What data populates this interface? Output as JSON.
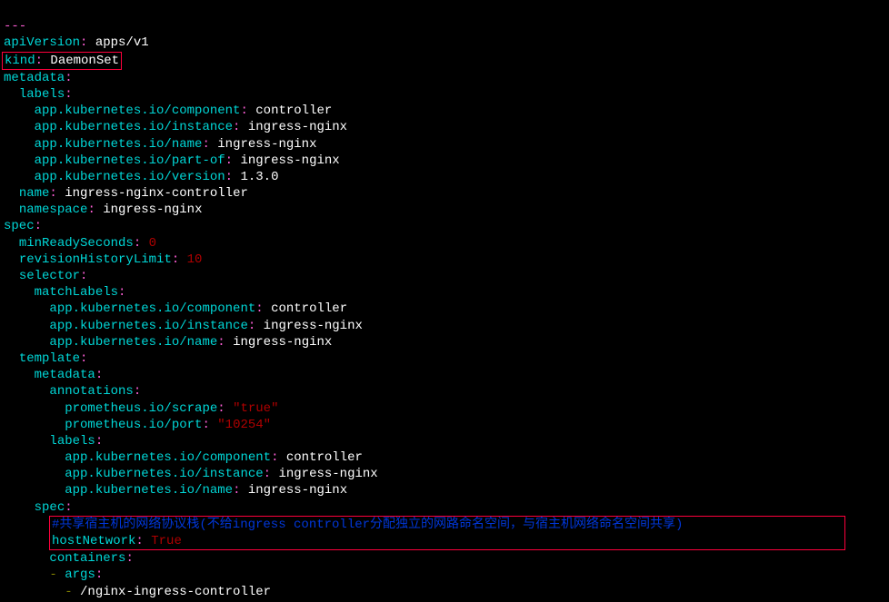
{
  "lines": {
    "sep": "---",
    "l1_k": "apiVersion",
    "l1_v": "apps/v1",
    "l2_k": "kind",
    "l2_v": "DaemonSet",
    "l3_k": "metadata",
    "l4_k": "labels",
    "l5_k": "app.kubernetes.io/component",
    "l5_v": "controller",
    "l6_k": "app.kubernetes.io/instance",
    "l6_v": "ingress-nginx",
    "l7_k": "app.kubernetes.io/name",
    "l7_v": "ingress-nginx",
    "l8_k": "app.kubernetes.io/part-of",
    "l8_v": "ingress-nginx",
    "l9_k": "app.kubernetes.io/version",
    "l9_v": "1.3.0",
    "l10_k": "name",
    "l10_v": "ingress-nginx-controller",
    "l11_k": "namespace",
    "l11_v": "ingress-nginx",
    "l12_k": "spec",
    "l13_k": "minReadySeconds",
    "l13_v": "0",
    "l14_k": "revisionHistoryLimit",
    "l14_v": "10",
    "l15_k": "selector",
    "l16_k": "matchLabels",
    "l17_k": "app.kubernetes.io/component",
    "l17_v": "controller",
    "l18_k": "app.kubernetes.io/instance",
    "l18_v": "ingress-nginx",
    "l19_k": "app.kubernetes.io/name",
    "l19_v": "ingress-nginx",
    "l20_k": "template",
    "l21_k": "metadata",
    "l22_k": "annotations",
    "l23_k": "prometheus.io/scrape",
    "l23_v": "\"true\"",
    "l24_k": "prometheus.io/port",
    "l24_v": "\"10254\"",
    "l25_k": "labels",
    "l26_k": "app.kubernetes.io/component",
    "l26_v": "controller",
    "l27_k": "app.kubernetes.io/instance",
    "l27_v": "ingress-nginx",
    "l28_k": "app.kubernetes.io/name",
    "l28_v": "ingress-nginx",
    "l29_k": "spec",
    "comment": "#共享宿主机的网络协议栈(不给ingress controller分配独立的网路命名空间，与宿主机网络命名空间共享)",
    "l31_k": "hostNetwork",
    "l31_v": "True",
    "l32_k": "containers",
    "dash": "-",
    "l33_k": "args",
    "l34_v": "/nginx-ingress-controller"
  }
}
